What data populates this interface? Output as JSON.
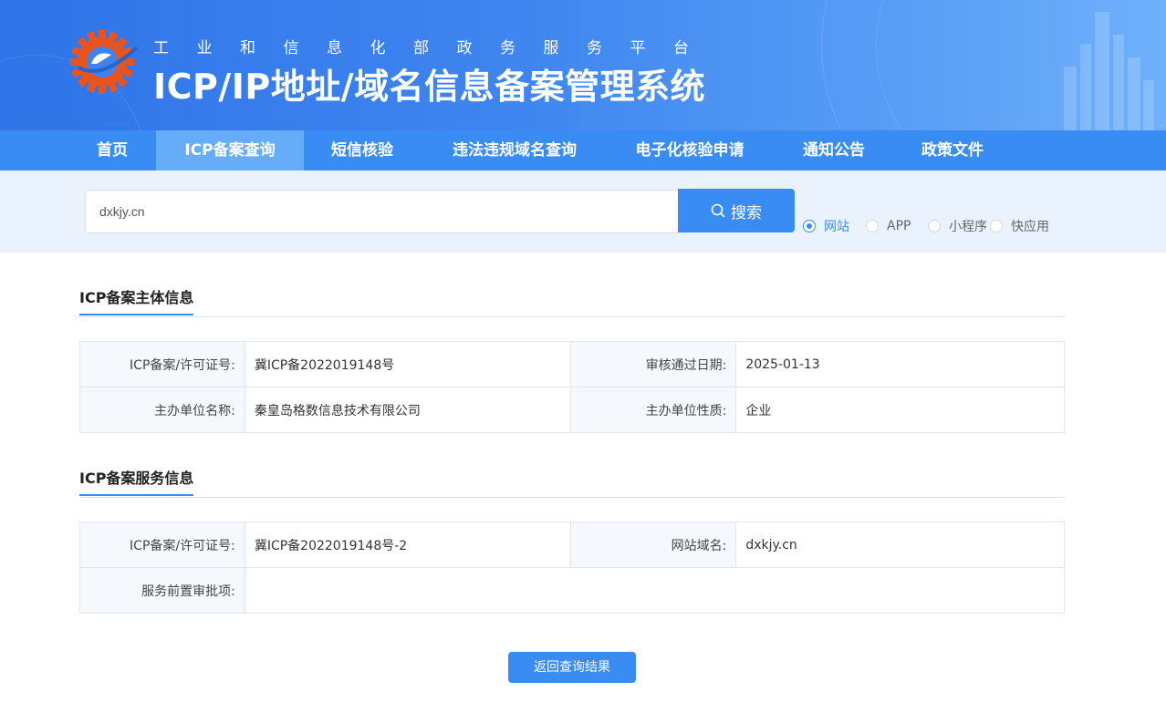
{
  "header": {
    "subtitle": "工业和信息化部政务服务平台",
    "title": "ICP/IP地址/域名信息备案管理系统",
    "logo_icon": "miit-gear-logo-icon"
  },
  "nav": {
    "items": [
      {
        "label": "首页"
      },
      {
        "label": "ICP备案查询",
        "active": true
      },
      {
        "label": "短信核验"
      },
      {
        "label": "违法违规域名查询"
      },
      {
        "label": "电子化核验申请"
      },
      {
        "label": "通知公告"
      },
      {
        "label": "政策文件"
      }
    ]
  },
  "search": {
    "value": "dxkjy.cn",
    "button_label": "搜索",
    "search_icon": "search-icon",
    "types": [
      {
        "label": "网站",
        "checked": true
      },
      {
        "label": "APP",
        "checked": false
      },
      {
        "label": "小程序",
        "checked": false
      },
      {
        "label": "快应用",
        "checked": false
      }
    ]
  },
  "subject_section": {
    "title": "ICP备案主体信息",
    "rows": [
      {
        "k1": "ICP备案/许可证号:",
        "v1": "冀ICP备2022019148号",
        "k2": "审核通过日期:",
        "v2": "2025-01-13"
      },
      {
        "k1": "主办单位名称:",
        "v1": "秦皇岛格数信息技术有限公司",
        "k2": "主办单位性质:",
        "v2": "企业"
      }
    ]
  },
  "service_section": {
    "title": "ICP备案服务信息",
    "row1": {
      "k1": "ICP备案/许可证号:",
      "v1": "冀ICP备2022019148号-2",
      "k2": "网站域名:",
      "v2": "dxkjy.cn"
    },
    "row2": {
      "k1": "服务前置审批项:",
      "v1": ""
    }
  },
  "back_button": "返回查询结果",
  "colors": {
    "primary": "#3a8cf5",
    "nav_active": "#66adf9",
    "search_band": "#eaf3fd",
    "logo_orange": "#e8541e"
  }
}
